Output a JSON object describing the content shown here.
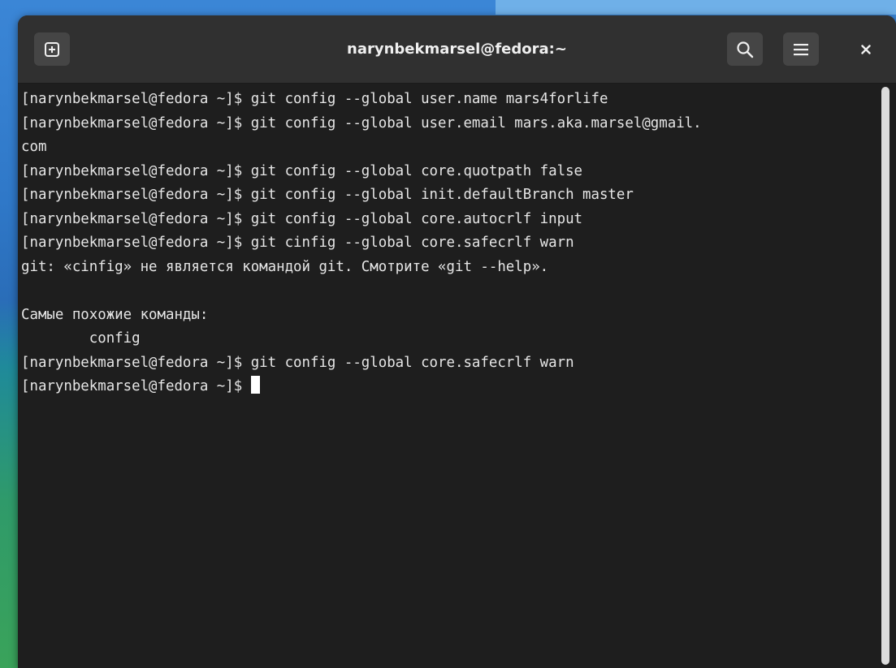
{
  "window": {
    "title": "narynbekmarsel@fedora:~"
  },
  "icons": {
    "new_tab": "new-tab-icon",
    "search": "search-icon",
    "menu": "hamburger-menu-icon",
    "close": "close-icon"
  },
  "colors": {
    "headerbar": "#303030",
    "terminal_bg": "#1e1e1e",
    "terminal_fg": "#e6e6e6",
    "button_bg": "#454545"
  },
  "terminal": {
    "lines": [
      "[narynbekmarsel@fedora ~]$ git config --global user.name mars4forlife",
      "[narynbekmarsel@fedora ~]$ git config --global user.email mars.aka.marsel@gmail.",
      "com",
      "[narynbekmarsel@fedora ~]$ git config --global core.quotpath false",
      "[narynbekmarsel@fedora ~]$ git config --global init.defaultBranch master",
      "[narynbekmarsel@fedora ~]$ git config --global core.autocrlf input",
      "[narynbekmarsel@fedora ~]$ git cinfig --global core.safecrlf warn",
      "git: «cinfig» не является командой git. Смотрите «git --help».",
      "",
      "Самые похожие команды:",
      "        config",
      "[narynbekmarsel@fedora ~]$ git config --global core.safecrlf warn"
    ],
    "prompt": "[narynbekmarsel@fedora ~]$ "
  }
}
